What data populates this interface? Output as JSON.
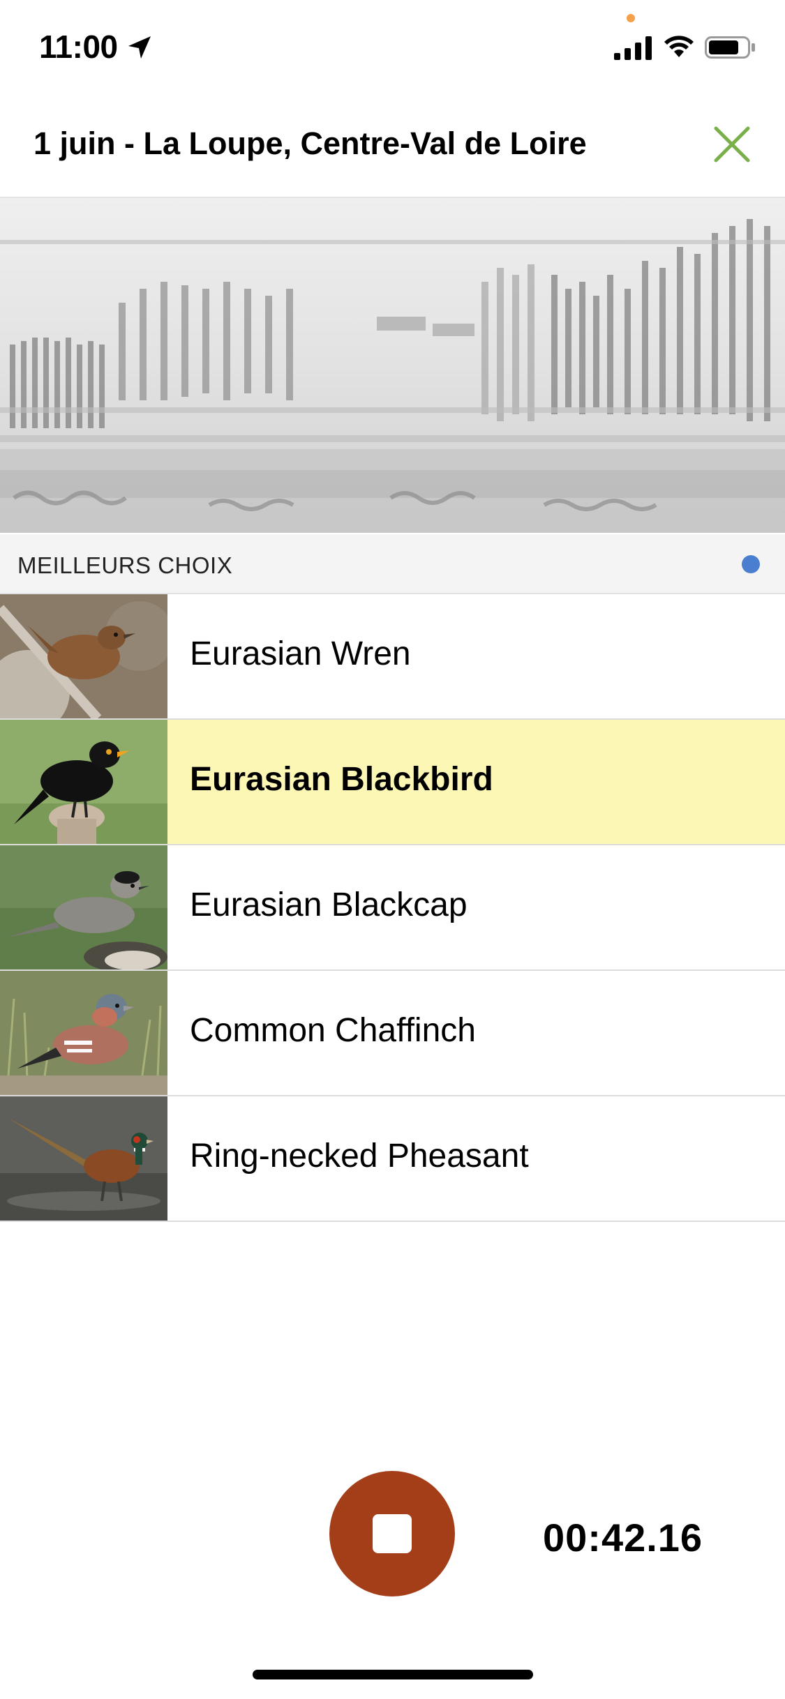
{
  "status_bar": {
    "time": "11:00"
  },
  "header": {
    "title": "1 juin - La Loupe, Centre-Val de Loire"
  },
  "section": {
    "label": "MEILLEURS CHOIX"
  },
  "species": [
    {
      "name": "Eurasian Wren",
      "selected": false
    },
    {
      "name": "Eurasian Blackbird",
      "selected": true
    },
    {
      "name": "Eurasian Blackcap",
      "selected": false
    },
    {
      "name": "Common Chaffinch",
      "selected": false
    },
    {
      "name": "Ring-necked Pheasant",
      "selected": false
    }
  ],
  "recorder": {
    "timer": "00:42.16"
  },
  "colors": {
    "accent_green": "#7ab04a",
    "stop_button": "#a43e18",
    "selected_row": "#fcf7b4",
    "section_dot": "#4a7ecf"
  }
}
